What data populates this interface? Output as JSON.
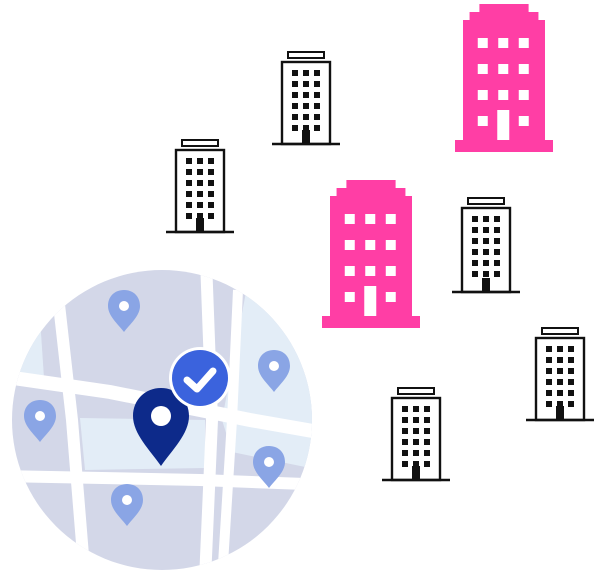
{
  "colors": {
    "background": "#ffffff",
    "brand_pink": "#ff3ea5",
    "outline_black": "#111111",
    "map_circle": "#d3d7e8",
    "map_water": "#e3edf7",
    "map_road": "#ffffff",
    "pin_light": "#8aa5e5",
    "pin_dark": "#0d2a8a",
    "check_badge": "#3b63dd"
  },
  "icons": {
    "building_outline": "office-building-outline-icon",
    "building_pink": "office-building-pink-icon",
    "map": "map-circle-icon",
    "pin": "location-pin-icon",
    "check": "checkmark-badge-icon"
  }
}
